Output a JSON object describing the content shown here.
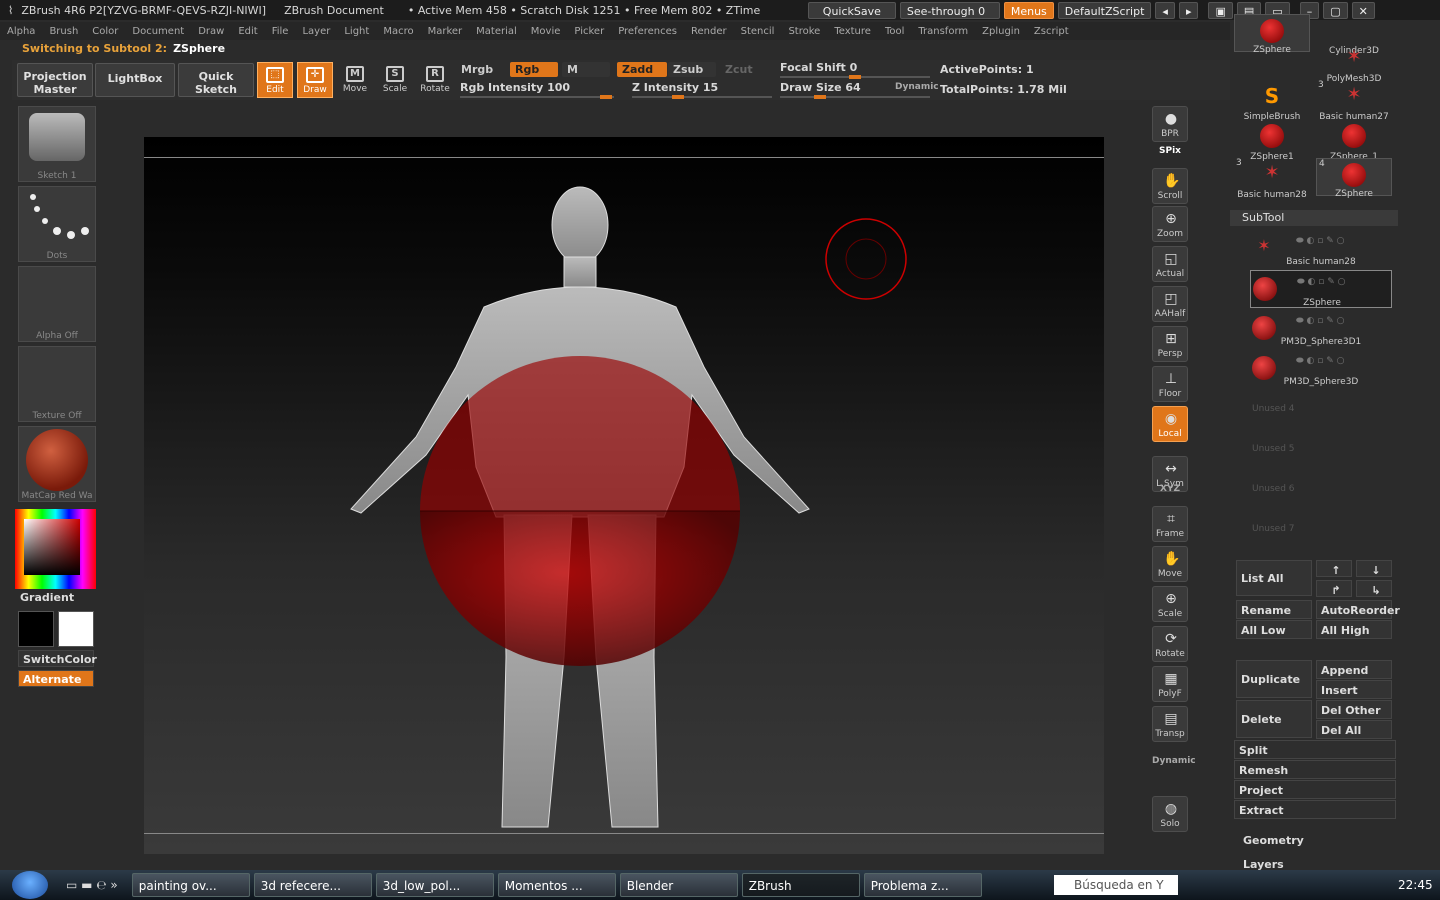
{
  "titlebar": {
    "app": "ZBrush 4R6 P2[YZVG-BRMF-QEVS-RZJI-NIWI]",
    "doc": "ZBrush Document",
    "mem": "• Active Mem 458 • Scratch Disk 1251 • Free Mem 802 • ZTime",
    "quicksave": "QuickSave",
    "seethrough": "See-through",
    "seethrough_val": "0",
    "menus": "Menus",
    "script": "DefaultZScript"
  },
  "menubar": [
    "Alpha",
    "Brush",
    "Color",
    "Document",
    "Draw",
    "Edit",
    "File",
    "Layer",
    "Light",
    "Macro",
    "Marker",
    "Material",
    "Movie",
    "Picker",
    "Preferences",
    "Render",
    "Stencil",
    "Stroke",
    "Texture",
    "Tool",
    "Transform",
    "Zplugin",
    "Zscript"
  ],
  "status": {
    "text": "Switching to Subtool 2:",
    "value": "ZSphere"
  },
  "toolbar": {
    "projection_master": "Projection Master",
    "lightbox": "LightBox",
    "quick_sketch": "Quick Sketch",
    "edit": "Edit",
    "draw": "Draw",
    "move": "Move",
    "scale": "Scale",
    "rotate": "Rotate",
    "mrgb": "Mrgb",
    "rgb": "Rgb",
    "m": "M",
    "zadd": "Zadd",
    "zsub": "Zsub",
    "zcut": "Zcut",
    "rgb_intensity": "Rgb Intensity 100",
    "z_intensity": "Z Intensity 15",
    "focal_shift": "Focal Shift 0",
    "draw_size": "Draw Size 64",
    "dynamic": "Dynamic",
    "active_points": "ActivePoints: 1",
    "total_points": "TotalPoints: 1.78 Mil"
  },
  "left": {
    "sketch": "Sketch 1",
    "dots": "Dots",
    "alpha": "Alpha Off",
    "texture": "Texture Off",
    "matcap": "MatCap Red Wa",
    "gradient": "Gradient",
    "switchcolor": "SwitchColor",
    "alternate": "Alternate"
  },
  "right_tools": [
    "BPR",
    "SPix",
    "Scroll",
    "Zoom",
    "Actual",
    "AAHalf",
    "Persp",
    "Floor",
    "Local",
    "L.Sym",
    "XYZ",
    "Frame",
    "Move",
    "Scale",
    "Rotate",
    "PolyF",
    "Transp",
    "Dynamic",
    "Solo"
  ],
  "tool_thumbs": [
    {
      "name": "ZSphere",
      "count": ""
    },
    {
      "name": "Cylinder3D",
      "count": ""
    },
    {
      "name": "PolyMesh3D",
      "count": ""
    },
    {
      "name": "SimpleBrush",
      "count": ""
    },
    {
      "name": "Basic human27",
      "count": "3"
    },
    {
      "name": "ZSphere1",
      "count": ""
    },
    {
      "name": "ZSphere_1",
      "count": ""
    },
    {
      "name": "Basic human28",
      "count": "3"
    },
    {
      "name": "ZSphere",
      "count": "4"
    }
  ],
  "subtool": {
    "header": "SubTool",
    "items": [
      "Basic human28",
      "ZSphere",
      "PM3D_Sphere3D1",
      "PM3D_Sphere3D"
    ],
    "unused": [
      "Unused 4",
      "Unused 5",
      "Unused 6",
      "Unused 7"
    ]
  },
  "panel_buttons": {
    "list_all": "List All",
    "rename": "Rename",
    "autoreorder": "AutoReorder",
    "all_low": "All Low",
    "all_high": "All High",
    "duplicate": "Duplicate",
    "append": "Append",
    "insert": "Insert",
    "delete": "Delete",
    "del_other": "Del Other",
    "del_all": "Del All",
    "split": "Split",
    "remesh": "Remesh",
    "project": "Project",
    "extract": "Extract",
    "geometry": "Geometry",
    "layers": "Layers"
  },
  "taskbar": {
    "tasks": [
      "painting ov...",
      "3d refecere...",
      "3d_low_pol...",
      "Momentos ...",
      "Blender",
      "ZBrush",
      "Problema z..."
    ],
    "search_placeholder": "Búsqueda en Y",
    "clock": "22:45"
  },
  "colors": {
    "accent": "#e0761a",
    "sphere": "#c00000"
  }
}
